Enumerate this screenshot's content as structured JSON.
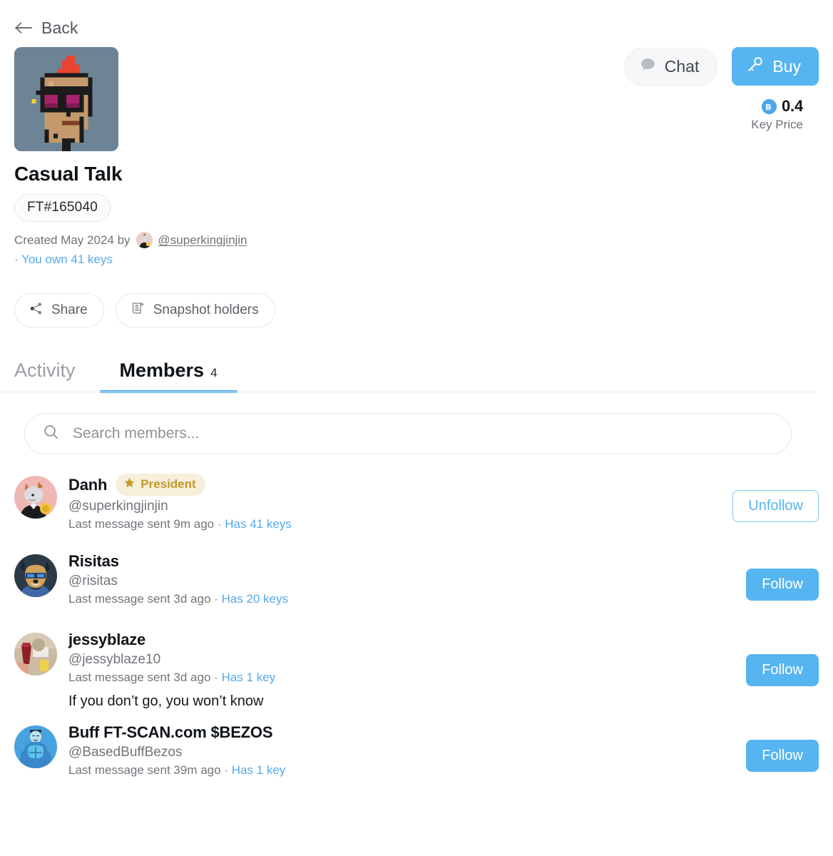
{
  "nav": {
    "back_label": "Back",
    "back_icon": "arrow-left-icon"
  },
  "header": {
    "title": "Casual Talk",
    "ft_badge": "FT#165040",
    "created_prefix": "Created May 2024 by",
    "creator_handle": "@superkingjinjin",
    "owned_keys": "· You own 41 keys",
    "avatar_icon": "cryptopunk-avatar",
    "creator_avatar_icon": "creator-avatar"
  },
  "actions": {
    "chat_label": "Chat",
    "chat_icon": "speech-bubble-icon",
    "buy_label": "Buy",
    "buy_icon": "key-icon",
    "price_value": "0.4",
    "price_caption": "Key Price",
    "price_coin_icon": "coin-icon"
  },
  "chips": [
    {
      "label": "Share",
      "icon": "share-nodes-icon"
    },
    {
      "label": "Snapshot holders",
      "icon": "scroll-document-icon"
    }
  ],
  "tabs": [
    {
      "label": "Activity",
      "count": "",
      "active": false
    },
    {
      "label": "Members",
      "count": "4",
      "active": true
    }
  ],
  "search": {
    "placeholder": "Search members...",
    "value": "",
    "icon": "search-icon"
  },
  "members": [
    {
      "name": "Danh",
      "badge": "President",
      "badge_icon": "star-icon",
      "handle": "@superkingjinjin",
      "meta_prefix": "Last message sent 9m ago",
      "meta_sep": "·",
      "keys": "Has 41 keys",
      "message": "",
      "action_label": "Unfollow",
      "action_style": "outline",
      "avatar_icon": "goat-suit-avatar"
    },
    {
      "name": "Risitas",
      "badge": "",
      "handle": "@risitas",
      "meta_prefix": "Last message sent 3d ago",
      "meta_sep": "·",
      "keys": "Has 20 keys",
      "message": "",
      "action_label": "Follow",
      "action_style": "filled",
      "avatar_icon": "dog-sunglasses-avatar"
    },
    {
      "name": "jessyblaze",
      "badge": "",
      "handle": "@jessyblaze10",
      "meta_prefix": "Last message sent 3d ago",
      "meta_sep": "·",
      "keys": "Has 1 key",
      "message": "If you don’t go, you won’t know",
      "action_label": "Follow",
      "action_style": "filled",
      "avatar_icon": "drinks-photo-avatar"
    },
    {
      "name": "Buff FT-SCAN.com $BEZOS",
      "badge": "",
      "handle": "@BasedBuffBezos",
      "meta_prefix": "Last message sent 39m ago",
      "meta_sep": "·",
      "keys": "Has 1 key",
      "message": "",
      "action_label": "Follow",
      "action_style": "filled",
      "avatar_icon": "buff-blue-figure-avatar"
    }
  ],
  "colors": {
    "accent_blue": "#56b4f0",
    "link_blue": "#57a9ec",
    "badge_gold": "#c2992c",
    "badge_bg": "#f6efda",
    "text_primary": "#0f1419",
    "text_muted": "#70757b"
  }
}
